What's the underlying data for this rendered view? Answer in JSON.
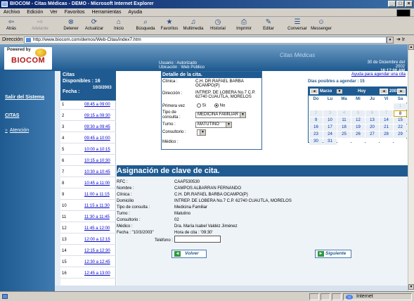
{
  "window": {
    "title": "BIOCOM - Citas Médicas - DEMO - Microsoft Internet Explorer",
    "buttons": [
      "_",
      "□",
      "×"
    ]
  },
  "menu": [
    "Archivo",
    "Edición",
    "Ver",
    "Favoritos",
    "Herramientas",
    "Ayuda"
  ],
  "toolbar": [
    {
      "label": "Atrás",
      "icon": "back-arrow-icon",
      "glyph": "⇦",
      "enabled": true
    },
    {
      "label": "Adelante",
      "icon": "forward-arrow-icon",
      "glyph": "⇨",
      "enabled": false
    },
    {
      "label": "Detener",
      "icon": "stop-icon",
      "glyph": "⊗",
      "enabled": true
    },
    {
      "label": "Actualizar",
      "icon": "refresh-icon",
      "glyph": "⟳",
      "enabled": true
    },
    {
      "label": "Inicio",
      "icon": "home-icon",
      "glyph": "⌂",
      "enabled": true
    },
    {
      "label": "Búsqueda",
      "icon": "search-icon",
      "glyph": "⌕",
      "enabled": true
    },
    {
      "label": "Favoritos",
      "icon": "favorites-icon",
      "glyph": "★",
      "enabled": true
    },
    {
      "label": "Multimedia",
      "icon": "multimedia-icon",
      "glyph": "♫",
      "enabled": true
    },
    {
      "label": "Historial",
      "icon": "history-icon",
      "glyph": "◷",
      "enabled": true
    },
    {
      "label": "Imprimir",
      "icon": "print-icon",
      "glyph": "⎙",
      "enabled": true
    },
    {
      "label": "Editar",
      "icon": "edit-icon",
      "glyph": "✎",
      "enabled": true
    },
    {
      "label": "Conversar",
      "icon": "discuss-icon",
      "glyph": "☰",
      "enabled": true
    },
    {
      "label": "Messenger",
      "icon": "messenger-icon",
      "glyph": "☺",
      "enabled": true
    }
  ],
  "address": {
    "label": "Dirección",
    "url": "http://www.biocom.com/demos/Web-Citas/index7.htm",
    "go": "Ir"
  },
  "header": {
    "powered_by": "Powered by",
    "brand": "BIOCOM",
    "user_line": "Usuario : Autorizado",
    "location_line": "Ubicación : Web Público",
    "site_title": "Citas Médicas",
    "date": "30 de Diciembre del 2002",
    "time": "16:17:00 AM"
  },
  "nav": {
    "logout": "Salir del Sistema",
    "citas": "CITAS",
    "atencion": "Atención",
    "tick": "»"
  },
  "slots": {
    "title_1": "Citas",
    "title_2": "Disponibles : 16",
    "date_label": "Fecha :",
    "date": "10/3/2003",
    "rows": [
      {
        "n": "1",
        "t": "08:45 a 09:00"
      },
      {
        "n": "2",
        "t": "09:15 a 09:30"
      },
      {
        "n": "3",
        "t": "09:30 a 09:45"
      },
      {
        "n": "4",
        "t": "09:45 a 10:00"
      },
      {
        "n": "5",
        "t": "10:00 a 10:15"
      },
      {
        "n": "6",
        "t": "10:15 a 10:30"
      },
      {
        "n": "7",
        "t": "10:30 a 10:45"
      },
      {
        "n": "8",
        "t": "10:45 a 11:00"
      },
      {
        "n": "9",
        "t": "11:00 a 11:15"
      },
      {
        "n": "10",
        "t": "11:15 a 11:30"
      },
      {
        "n": "11",
        "t": "11:30 a 11:45"
      },
      {
        "n": "12",
        "t": "11:45 a 12:00"
      },
      {
        "n": "13",
        "t": "12:00 a 12:15"
      },
      {
        "n": "14",
        "t": "12:15 a 12:30"
      },
      {
        "n": "15",
        "t": "12:30 a 12:45"
      },
      {
        "n": "16",
        "t": "12:45 a 13:00"
      }
    ]
  },
  "detail": {
    "title": "Detalle de la cita.",
    "clinica_label": "Clínica :",
    "clinica_1": "C.H. DR.RAFAEL BARBA",
    "clinica_2": "OCAMPO(P)",
    "direccion_label": "Dirección :",
    "direccion_1": "INTREP. DE LOBERA No.7 C.P.",
    "direccion_2": "62740 CUAUTLA, MORELOS",
    "primera_label": "Primera vez",
    "si": "Si",
    "no": "No",
    "tipo_label_1": "Tipo de",
    "tipo_label_2": "consulta :",
    "tipo_value": "MEDICINA FAMILIAR",
    "turno_label": "Turno :",
    "turno_value": "MATUTINO",
    "consultorio_label": "Consultorio :",
    "consultorio_value": "",
    "medico_label": "Médico :",
    "medico_value": ""
  },
  "help_link": "Ayuda para agendar una cita",
  "calendar": {
    "days_possible": "Días posibles a agendar : 15",
    "month": "Marzo",
    "today": "Hoy",
    "year": "2003",
    "prev": "◄",
    "next": "►",
    "headers": [
      "Do",
      "Lu",
      "Ma",
      "Mi",
      "Ju",
      "Vi",
      "Sa"
    ],
    "cells": [
      {
        "d": "",
        "s": "e"
      },
      {
        "d": "",
        "s": "e"
      },
      {
        "d": "",
        "s": "e"
      },
      {
        "d": "",
        "s": "e"
      },
      {
        "d": "",
        "s": "e"
      },
      {
        "d": "",
        "s": "e"
      },
      {
        "d": "1",
        "s": "past"
      },
      {
        "d": "2",
        "s": "past"
      },
      {
        "d": "3",
        "s": "past"
      },
      {
        "d": "4",
        "s": "past"
      },
      {
        "d": "5",
        "s": "past"
      },
      {
        "d": "6",
        "s": "past"
      },
      {
        "d": "7",
        "s": "past"
      },
      {
        "d": "8",
        "s": "today"
      },
      {
        "d": "9",
        "s": "d"
      },
      {
        "d": "10",
        "s": "d"
      },
      {
        "d": "11",
        "s": "d"
      },
      {
        "d": "12",
        "s": "d"
      },
      {
        "d": "13",
        "s": "d"
      },
      {
        "d": "14",
        "s": "d"
      },
      {
        "d": "15",
        "s": "d"
      },
      {
        "d": "16",
        "s": "d"
      },
      {
        "d": "17",
        "s": "d"
      },
      {
        "d": "18",
        "s": "d"
      },
      {
        "d": "19",
        "s": "d"
      },
      {
        "d": "20",
        "s": "d"
      },
      {
        "d": "21",
        "s": "d"
      },
      {
        "d": "22",
        "s": "d"
      },
      {
        "d": "23",
        "s": "d"
      },
      {
        "d": "24",
        "s": "d"
      },
      {
        "d": "25",
        "s": "d"
      },
      {
        "d": "26",
        "s": "d"
      },
      {
        "d": "27",
        "s": "d"
      },
      {
        "d": "28",
        "s": "d"
      },
      {
        "d": "29",
        "s": "d"
      },
      {
        "d": "30",
        "s": "d"
      },
      {
        "d": "31",
        "s": "d"
      },
      {
        "d": "",
        "s": "e"
      },
      {
        "d": "",
        "s": "e"
      },
      {
        "d": "",
        "s": "e"
      },
      {
        "d": "",
        "s": "e"
      },
      {
        "d": "",
        "s": "e"
      }
    ]
  },
  "assign": {
    "title": "Asignación de clave de cita.",
    "rows": [
      {
        "k": "RFC :",
        "v": "CAAF530530"
      },
      {
        "k": "Nombre :",
        "v": "CAMPOS ALBARRAN FERNANDO"
      },
      {
        "k": "Clínica :",
        "v": "C.H. DR.RAFAEL BARBA OCAMPO(P)"
      },
      {
        "k": "Domicilio",
        "v": "INTREP. DE LOBERA No.7 C.P. 62740 CUAUTLA, MORELOS"
      },
      {
        "k": "Tipo de consulta :",
        "v": "Medicina Familiar"
      },
      {
        "k": "Turno :",
        "v": "Matutino"
      },
      {
        "k": "Consultorio :",
        "v": "02"
      },
      {
        "k": "Médico :",
        "v": "Dra. María Isabel Valdéz Jiménez"
      },
      {
        "k": "Fecha : \"10/3/2003\"",
        "v": "Hora de cita : '09:30'"
      }
    ],
    "phone_label": "Teléfono :",
    "back": "Volver",
    "next": "Siguiente"
  },
  "status": {
    "zone": "Internet"
  }
}
